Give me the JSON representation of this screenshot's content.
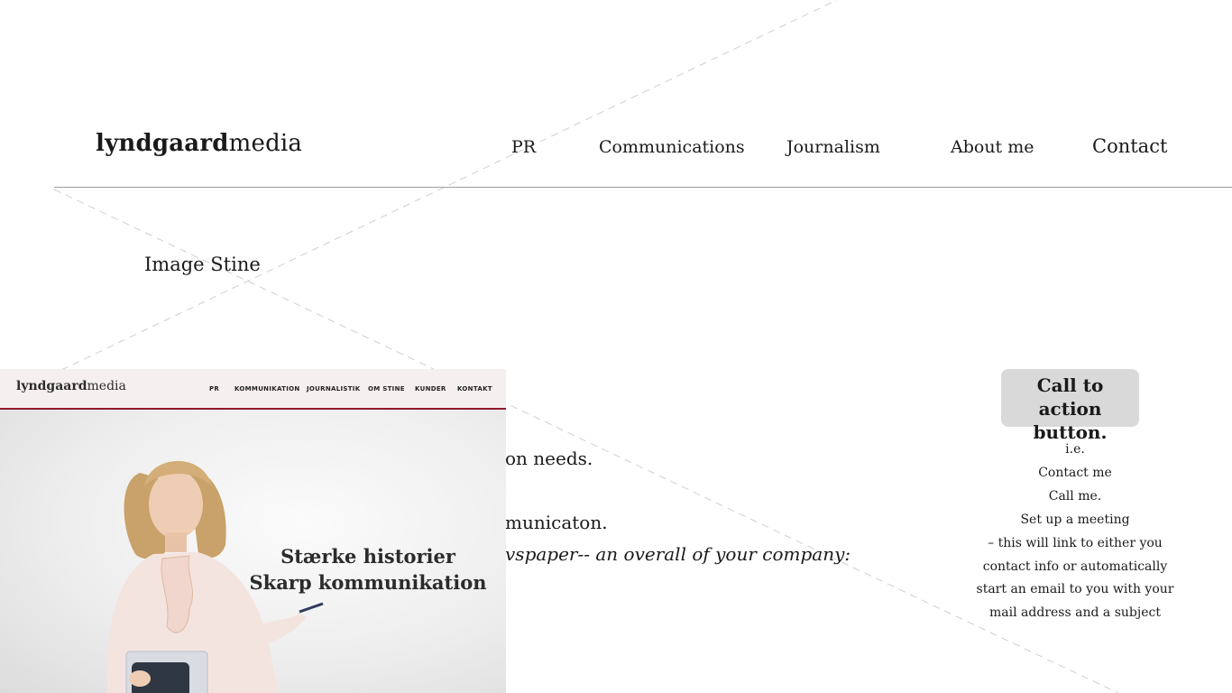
{
  "header": {
    "logo_bold": "lyndgaard",
    "logo_light": "media",
    "nav": {
      "pr": "PR",
      "communications": "Communications",
      "journalism": "Journalism",
      "about": "About me",
      "contact": "Contact"
    }
  },
  "image_placeholder": "Image Stine",
  "copy": {
    "line1": "on needs.",
    "line2": "municaton.",
    "line3": "vspaper-- an overall of your company:"
  },
  "cta": {
    "line1": "Call to action",
    "line2": "button.",
    "notes": [
      "i.e.",
      "Contact me",
      "Call me.",
      "Set up a meeting",
      "– this will link to either you",
      "contact info or automatically",
      "start an email to you with your",
      "mail address and a subject"
    ]
  },
  "screenshot": {
    "logo_bold": "lyndgaard",
    "logo_light": "media",
    "nav": [
      "PR",
      "KOMMUNIKATION",
      "JOURNALISTIK",
      "OM STINE",
      "KUNDER",
      "KONTAKT"
    ],
    "heading_line1": "Stærke historier",
    "heading_line2": "Skarp kommunikation",
    "accent_color": "#8e1b2b"
  },
  "colors": {
    "divider": "#9e9e9e",
    "cta_bg": "#d9d9d9",
    "cross_lines": "#cfcfcf"
  }
}
